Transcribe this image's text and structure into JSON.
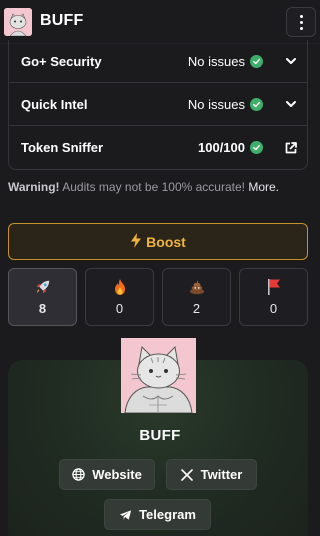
{
  "header": {
    "brand": "BUFF",
    "logo_icon": "cat-logo-icon",
    "menu_icon": "vertical-dots-icon"
  },
  "audits": [
    {
      "name": "Go+ Security",
      "status": "No issues",
      "status_icon": "check-circle-icon",
      "action_icon": "chevron-down-icon"
    },
    {
      "name": "Quick Intel",
      "status": "No issues",
      "status_icon": "check-circle-icon",
      "action_icon": "chevron-down-icon"
    },
    {
      "name": "Token Sniffer",
      "status": "100/100",
      "status_icon": "check-circle-icon",
      "action_icon": "external-link-icon"
    }
  ],
  "warning": {
    "strong": "Warning!",
    "text": "Audits may not be 100% accurate!",
    "link": "More."
  },
  "boost": {
    "icon": "lightning-icon",
    "label": "Boost"
  },
  "reactions": [
    {
      "icon": "rocket-icon",
      "count": "8",
      "active": true
    },
    {
      "icon": "fire-icon",
      "count": "0",
      "active": false
    },
    {
      "icon": "poop-icon",
      "count": "2",
      "active": false
    },
    {
      "icon": "red-flag-icon",
      "count": "0",
      "active": false
    }
  ],
  "profile": {
    "name": "BUFF",
    "avatar_icon": "muscular-cat-avatar",
    "links": [
      {
        "label": "Website",
        "icon": "globe-icon"
      },
      {
        "label": "Twitter",
        "icon": "x-logo-icon"
      },
      {
        "label": "Telegram",
        "icon": "telegram-icon"
      }
    ]
  },
  "colors": {
    "background": "#1b1b1e",
    "check_green": "#3fae6a",
    "boost_accent": "#f0b43a",
    "avatar_bg": "#f4c6cf"
  }
}
